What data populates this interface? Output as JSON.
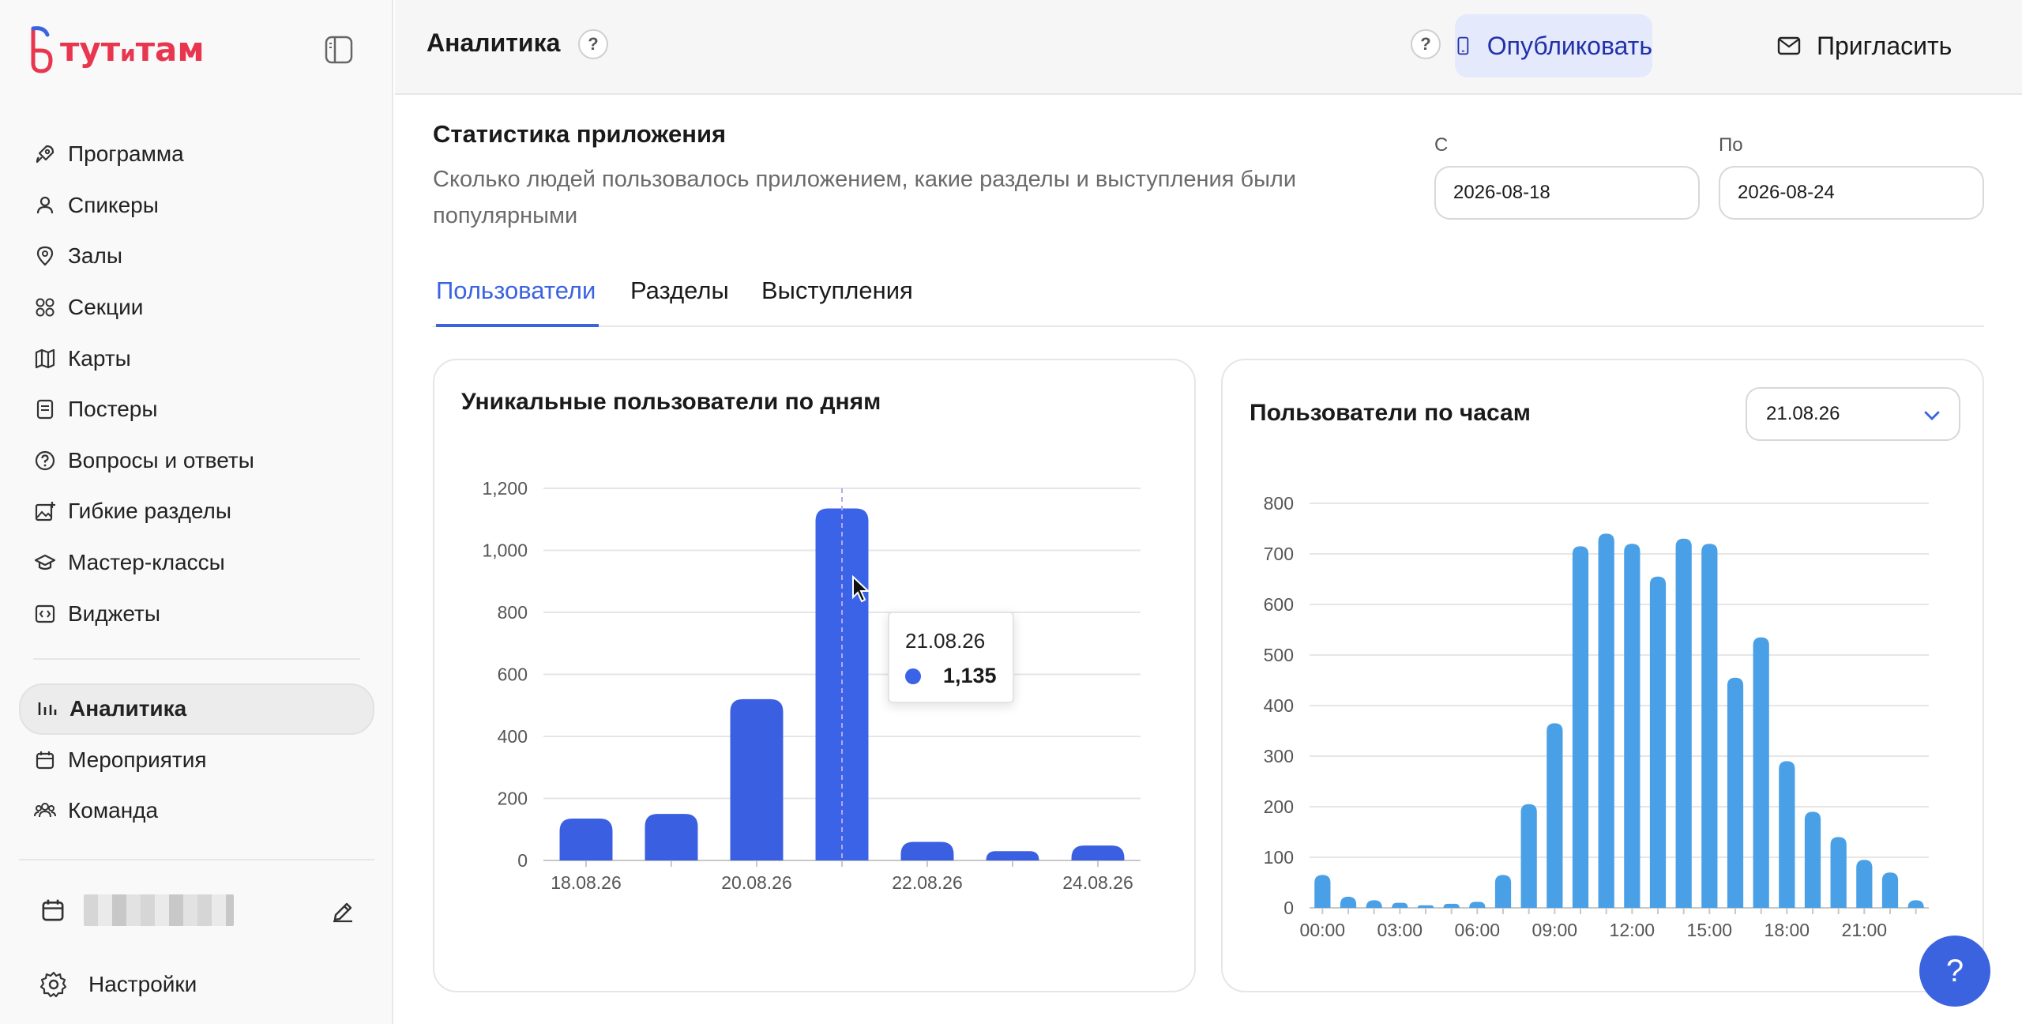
{
  "app": {
    "logo_text_a": "тут",
    "logo_text_b": "и",
    "logo_text_c": "там",
    "brand_color": "#e8364f",
    "accent_color": "#3b63e0"
  },
  "sidebar": {
    "items": [
      {
        "label": "Программа",
        "icon": "rocket-icon"
      },
      {
        "label": "Спикеры",
        "icon": "person-icon"
      },
      {
        "label": "Залы",
        "icon": "map-pin-icon"
      },
      {
        "label": "Секции",
        "icon": "grid-circles-icon"
      },
      {
        "label": "Карты",
        "icon": "map-icon"
      },
      {
        "label": "Постеры",
        "icon": "poster-icon"
      },
      {
        "label": "Вопросы и ответы",
        "icon": "question-icon"
      },
      {
        "label": "Гибкие разделы",
        "icon": "image-plus-icon"
      },
      {
        "label": "Мастер-классы",
        "icon": "graduation-cap-icon"
      },
      {
        "label": "Виджеты",
        "icon": "code-icon"
      }
    ],
    "items2": [
      {
        "label": "Аналитика",
        "icon": "chart-bars-icon",
        "active": true
      },
      {
        "label": "Мероприятия",
        "icon": "calendar-icon"
      },
      {
        "label": "Команда",
        "icon": "team-icon"
      }
    ],
    "settings_label": "Настройки"
  },
  "header": {
    "title": "Аналитика",
    "help": "?",
    "publish_label": "Опубликовать",
    "invite_label": "Пригласить"
  },
  "main": {
    "title": "Статистика приложения",
    "description": "Сколько людей пользовалось приложением, какие разделы и выступления были популярными",
    "date_from_label": "С",
    "date_from_value": "2026-08-18",
    "date_to_label": "По",
    "date_to_value": "2026-08-24",
    "tabs": [
      "Пользователи",
      "Разделы",
      "Выступления"
    ],
    "help_fab": "?"
  },
  "chart_data": [
    {
      "type": "bar",
      "title": "Уникальные пользователи по дням",
      "categories": [
        "18.08.26",
        "19.08.26",
        "20.08.26",
        "21.08.26",
        "22.08.26",
        "23.08.26",
        "24.08.26"
      ],
      "x_tick_labels": [
        "18.08.26",
        "",
        "20.08.26",
        "",
        "22.08.26",
        "",
        "24.08.26"
      ],
      "values": [
        135,
        150,
        520,
        1135,
        60,
        30,
        48
      ],
      "ylim": [
        0,
        1200
      ],
      "y_ticks": [
        0,
        200,
        400,
        600,
        800,
        1000,
        1200
      ],
      "y_tick_labels": [
        "0",
        "200",
        "400",
        "600",
        "800",
        "1,000",
        "1,200"
      ],
      "color": "#3a5fe0",
      "grid": true,
      "tooltip": {
        "category": "21.08.26",
        "value": "1,135"
      }
    },
    {
      "type": "bar",
      "title": "Пользователи по часам",
      "selected_date": "21.08.26",
      "categories": [
        "00:00",
        "01:00",
        "02:00",
        "03:00",
        "04:00",
        "05:00",
        "06:00",
        "07:00",
        "08:00",
        "09:00",
        "10:00",
        "11:00",
        "12:00",
        "13:00",
        "14:00",
        "15:00",
        "16:00",
        "17:00",
        "18:00",
        "19:00",
        "20:00",
        "21:00",
        "22:00",
        "23:00"
      ],
      "x_tick_labels": [
        "00:00",
        "",
        "",
        "03:00",
        "",
        "",
        "06:00",
        "",
        "",
        "09:00",
        "",
        "",
        "12:00",
        "",
        "",
        "15:00",
        "",
        "",
        "18:00",
        "",
        "",
        "21:00",
        "",
        ""
      ],
      "values": [
        65,
        22,
        15,
        10,
        5,
        8,
        12,
        65,
        205,
        365,
        715,
        740,
        720,
        655,
        730,
        720,
        455,
        535,
        290,
        190,
        140,
        95,
        70,
        15
      ],
      "ylim": [
        0,
        800
      ],
      "y_ticks": [
        0,
        100,
        200,
        300,
        400,
        500,
        600,
        700,
        800
      ],
      "y_tick_labels": [
        "0",
        "100",
        "200",
        "300",
        "400",
        "500",
        "600",
        "700",
        "800"
      ],
      "color": "#4aa0e6",
      "grid": true
    }
  ]
}
